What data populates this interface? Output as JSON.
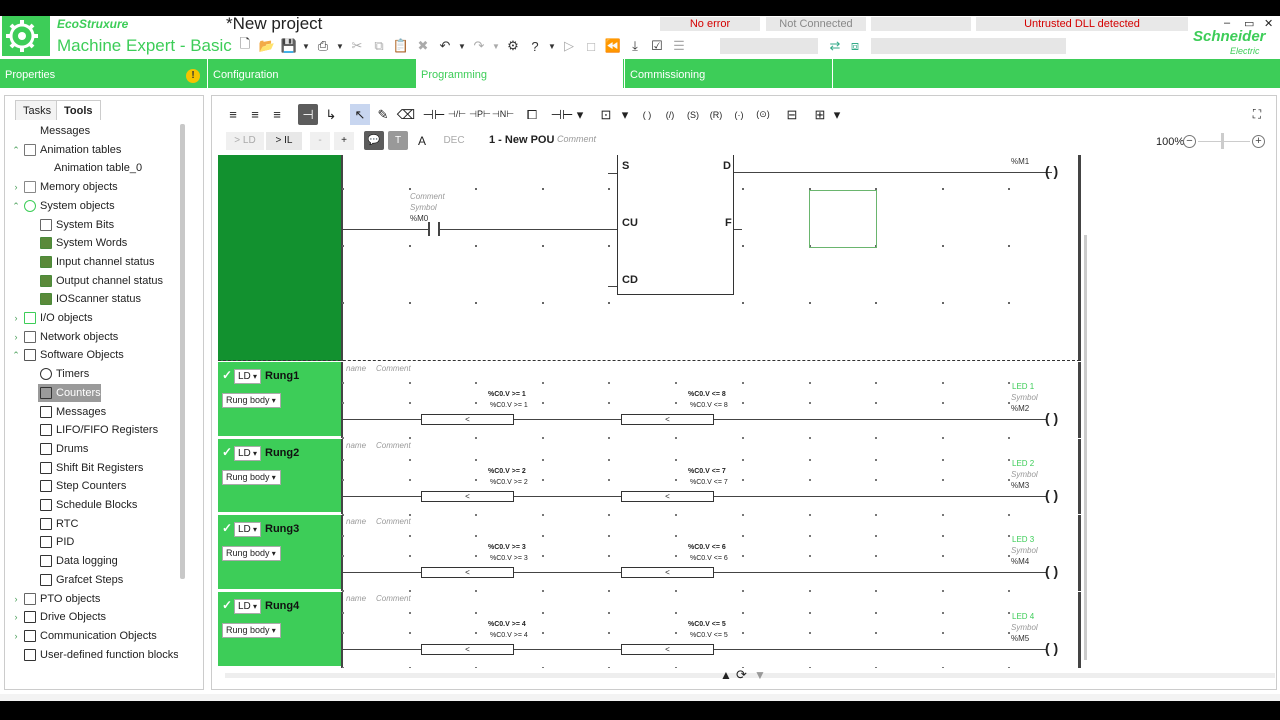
{
  "app": {
    "brand_line1": "EcoStruxure",
    "brand_line2": "Machine Expert - Basic",
    "project_title": "*New project",
    "status_error": "No error",
    "status_connection": "Not Connected",
    "status_dll": "Untrusted DLL detected",
    "vendor": "Schneider",
    "vendor_sub": "Electric",
    "colors": {
      "accent": "#3dcd58",
      "accent_dark": "#12912f",
      "warning": "#d40000"
    }
  },
  "nav": {
    "properties": "Properties",
    "configuration": "Configuration",
    "programming": "Programming",
    "commissioning": "Commissioning"
  },
  "left": {
    "tabs": [
      "Tasks",
      "Tools"
    ],
    "tree": [
      {
        "label": "Messages",
        "icon": "none-icon"
      },
      {
        "label": "Animation tables",
        "icon": "table-icon"
      },
      {
        "label": "Animation table_0",
        "icon": "none-icon"
      },
      {
        "label": "Memory objects",
        "icon": "memory-icon"
      },
      {
        "label": "System objects",
        "icon": "gear-icon"
      },
      {
        "label": "System Bits",
        "icon": "bits-icon"
      },
      {
        "label": "System Words",
        "icon": "words-icon"
      },
      {
        "label": "Input channel status",
        "icon": "words-icon"
      },
      {
        "label": "Output channel status",
        "icon": "words-icon"
      },
      {
        "label": "IOScanner status",
        "icon": "words-icon"
      },
      {
        "label": "I/O objects",
        "icon": "io-icon"
      },
      {
        "label": "Network objects",
        "icon": "network-icon"
      },
      {
        "label": "Software Objects",
        "icon": "software-icon"
      },
      {
        "label": "Timers",
        "icon": "clock-icon"
      },
      {
        "label": "Counters",
        "icon": "counter-icon"
      },
      {
        "label": "Messages",
        "icon": "message-icon"
      },
      {
        "label": "LIFO/FIFO Registers",
        "icon": "register-icon"
      },
      {
        "label": "Drums",
        "icon": "drum-icon"
      },
      {
        "label": "Shift Bit Registers",
        "icon": "shift-icon"
      },
      {
        "label": "Step Counters",
        "icon": "step-icon"
      },
      {
        "label": "Schedule Blocks",
        "icon": "schedule-icon"
      },
      {
        "label": "RTC",
        "icon": "rtc-icon"
      },
      {
        "label": "PID",
        "icon": "pid-icon"
      },
      {
        "label": "Data logging",
        "icon": "datalog-icon"
      },
      {
        "label": "Grafcet Steps",
        "icon": "grafcet-icon"
      },
      {
        "label": "PTO objects",
        "icon": "pto-icon"
      },
      {
        "label": "Drive Objects",
        "icon": "drive-icon"
      },
      {
        "label": "Communication Objects",
        "icon": "comm-icon"
      },
      {
        "label": "User-defined function blocks",
        "icon": "udfb-icon"
      }
    ]
  },
  "editor": {
    "btn_ld": "> LD",
    "btn_il": "> IL",
    "btn_minus": "-",
    "btn_plus": "+",
    "btn_dec": "DEC",
    "pou_title": "1 - New POU",
    "pou_comment": "Comment",
    "zoom": "100%",
    "rung0": {
      "contact_comment": "Comment",
      "contact_symbol": "Symbol",
      "contact_address": "%M0",
      "pin_s": "S",
      "pin_cu": "CU",
      "pin_cd": "CD",
      "pin_d": "D",
      "pin_f": "F",
      "coil_address": "%M1"
    },
    "rungs": [
      {
        "name": "Rung1",
        "lang": "LD",
        "body": "Rung body",
        "label_name": "name",
        "label_comment": "Comment",
        "cmp1_top": "%C0.V >= 1",
        "cmp1_sub": "%C0.V >= 1",
        "cmp1_op": "<",
        "cmp2_top": "%C0.V <= 8",
        "cmp2_sub": "%C0.V <= 8",
        "cmp2_op": "<",
        "coil_comment": "LED 1",
        "coil_symbol": "Symbol",
        "coil_address": "%M2"
      },
      {
        "name": "Rung2",
        "lang": "LD",
        "body": "Rung body",
        "label_name": "name",
        "label_comment": "Comment",
        "cmp1_top": "%C0.V >= 2",
        "cmp1_sub": "%C0.V >= 2",
        "cmp1_op": "<",
        "cmp2_top": "%C0.V <= 7",
        "cmp2_sub": "%C0.V <= 7",
        "cmp2_op": "<",
        "coil_comment": "LED 2",
        "coil_symbol": "Symbol",
        "coil_address": "%M3"
      },
      {
        "name": "Rung3",
        "lang": "LD",
        "body": "Rung body",
        "label_name": "name",
        "label_comment": "Comment",
        "cmp1_top": "%C0.V >= 3",
        "cmp1_sub": "%C0.V >= 3",
        "cmp1_op": "<",
        "cmp2_top": "%C0.V <= 6",
        "cmp2_sub": "%C0.V <= 6",
        "cmp2_op": "<",
        "coil_comment": "LED 3",
        "coil_symbol": "Symbol",
        "coil_address": "%M4"
      },
      {
        "name": "Rung4",
        "lang": "LD",
        "body": "Rung body",
        "label_name": "name",
        "label_comment": "Comment",
        "cmp1_top": "%C0.V >= 4",
        "cmp1_sub": "%C0.V >= 4",
        "cmp1_op": "<",
        "cmp2_top": "%C0.V <= 5",
        "cmp2_sub": "%C0.V <= 5",
        "cmp2_op": "<",
        "coil_comment": "LED 4",
        "coil_symbol": "Symbol",
        "coil_address": "%M5"
      }
    ]
  }
}
